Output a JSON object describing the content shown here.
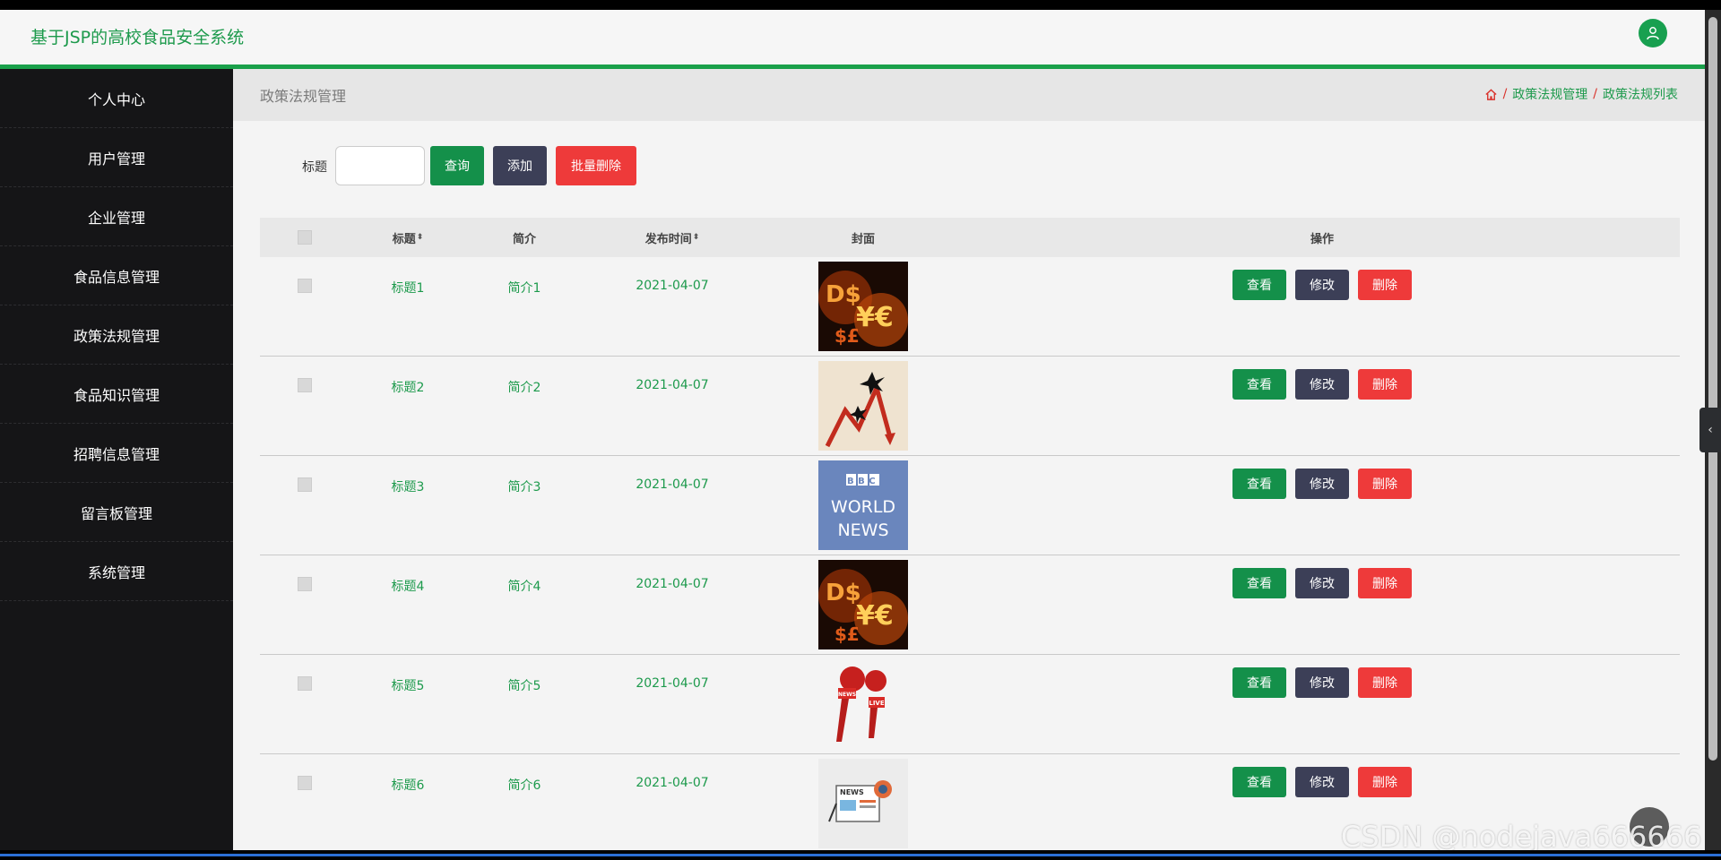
{
  "app": {
    "title": "基于JSP的高校食品安全系统"
  },
  "sidebar": {
    "items": [
      {
        "label": "个人中心"
      },
      {
        "label": "用户管理"
      },
      {
        "label": "企业管理"
      },
      {
        "label": "食品信息管理"
      },
      {
        "label": "政策法规管理"
      },
      {
        "label": "食品知识管理"
      },
      {
        "label": "招聘信息管理"
      },
      {
        "label": "留言板管理"
      },
      {
        "label": "系统管理"
      }
    ]
  },
  "page": {
    "title": "政策法规管理",
    "breadcrumb": [
      "政策法规管理",
      "政策法规列表"
    ]
  },
  "search": {
    "label": "标题",
    "value": "",
    "query_label": "查询",
    "add_label": "添加",
    "bulk_delete_label": "批量删除"
  },
  "table": {
    "headers": {
      "title": "标题",
      "intro": "简介",
      "date": "发布时间",
      "cover": "封面",
      "ops": "操作"
    },
    "ops": {
      "view": "查看",
      "edit": "修改",
      "delete": "删除"
    },
    "rows": [
      {
        "title": "标题1",
        "intro": "简介1",
        "date": "2021-04-07",
        "cover": "money-fire"
      },
      {
        "title": "标题2",
        "intro": "简介2",
        "date": "2021-04-07",
        "cover": "stock-crash"
      },
      {
        "title": "标题3",
        "intro": "简介3",
        "date": "2021-04-07",
        "cover": "bbc-world-news"
      },
      {
        "title": "标题4",
        "intro": "简介4",
        "date": "2021-04-07",
        "cover": "money-fire"
      },
      {
        "title": "标题5",
        "intro": "简介5",
        "date": "2021-04-07",
        "cover": "news-microphones"
      },
      {
        "title": "标题6",
        "intro": "简介6",
        "date": "2021-04-07",
        "cover": "news-paper"
      }
    ]
  },
  "cover_texts": {
    "bbc": "BBC",
    "world": "WORLD",
    "news": "NEWS",
    "live": "LIVE",
    "news_small": "NEWS"
  },
  "watermark": "CSDN @nodejava666666",
  "colors": {
    "accent": "#19a04a",
    "sidebar": "#151517",
    "danger": "#ee3a3a",
    "dark": "#3c3f57"
  }
}
